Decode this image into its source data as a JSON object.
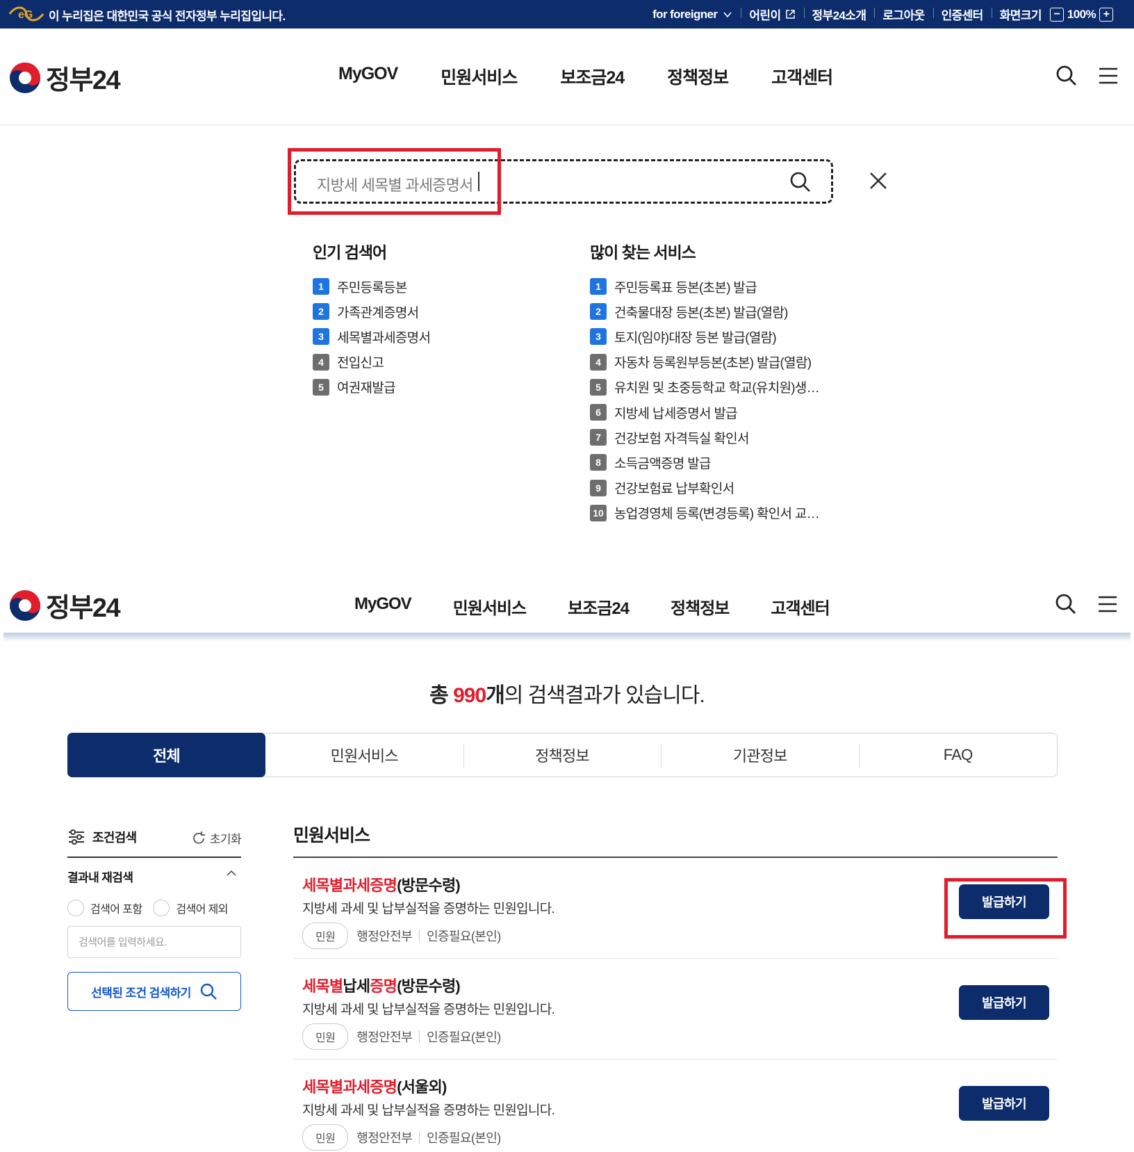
{
  "topbar": {
    "official_notice": "이 누리집은 대한민국 공식 전자정부 누리집입니다.",
    "links": {
      "foreigner": "for foreigner",
      "kids": "어린이",
      "about": "정부24소개",
      "logout": "로그아웃",
      "cert_center": "인증센터",
      "screen_size": "화면크기"
    },
    "zoom_minus": "−",
    "zoom_value": "100%",
    "zoom_plus": "+"
  },
  "header": {
    "logo_text": "정부24",
    "nav": [
      "MyGOV",
      "민원서비스",
      "보조금24",
      "정책정보",
      "고객센터"
    ]
  },
  "search": {
    "query": "지방세 세목별 과세증명서"
  },
  "popular": {
    "title": "인기 검색어",
    "items": [
      {
        "rank": "1",
        "label": "주민등록등본"
      },
      {
        "rank": "2",
        "label": "가족관계증명서"
      },
      {
        "rank": "3",
        "label": "세목별과세증명서"
      },
      {
        "rank": "4",
        "label": "전입신고"
      },
      {
        "rank": "5",
        "label": "여권재발급"
      }
    ]
  },
  "frequent": {
    "title": "많이 찾는 서비스",
    "items": [
      {
        "rank": "1",
        "label": "주민등록표 등본(초본) 발급"
      },
      {
        "rank": "2",
        "label": "건축물대장 등본(초본) 발급(열람)"
      },
      {
        "rank": "3",
        "label": "토지(임야)대장 등본 발급(열람)"
      },
      {
        "rank": "4",
        "label": "자동차 등록원부등본(초본) 발급(열람)"
      },
      {
        "rank": "5",
        "label": "유치원 및 초중등학교 학교(유치원)생…"
      },
      {
        "rank": "6",
        "label": "지방세 납세증명서 발급"
      },
      {
        "rank": "7",
        "label": "건강보험 자격득실 확인서"
      },
      {
        "rank": "8",
        "label": "소득금액증명 발급"
      },
      {
        "rank": "9",
        "label": "건강보험료 납부확인서"
      },
      {
        "rank": "10",
        "label": "농업경영체 등록(변경등록) 확인서 교…"
      }
    ]
  },
  "results": {
    "summary_prefix": "총",
    "count": "990",
    "summary_unit": "개",
    "summary_suffix": "의 검색결과가 있습니다.",
    "tabs": [
      "전체",
      "민원서비스",
      "정책정보",
      "기관정보",
      "FAQ"
    ],
    "active_tab": "전체",
    "filter": {
      "title": "조건검색",
      "reset": "초기화",
      "refine_title": "결과내 재검색",
      "include_label": "검색어 포함",
      "exclude_label": "검색어 제외",
      "input_placeholder": "검색어를 입력하세요.",
      "search_button": "선택된 조건 검색하기"
    },
    "section_title": "민원서비스",
    "items": [
      {
        "title_parts": [
          {
            "text": "세목별과세증명",
            "hl": true
          },
          {
            "text": "(방문수령)",
            "hl": false
          }
        ],
        "desc": "지방세 과세 및 납부실적을 증명하는 민원입니다.",
        "tag": "민원",
        "org": "행정안전부",
        "auth": "인증필요(본인)",
        "button": "발급하기"
      },
      {
        "title_parts": [
          {
            "text": "세목별",
            "hl": true
          },
          {
            "text": "납세",
            "hl": false
          },
          {
            "text": "증명",
            "hl": true
          },
          {
            "text": "(방문수령)",
            "hl": false
          }
        ],
        "desc": "지방세 과세 및 납부실적을 증명하는 민원입니다.",
        "tag": "민원",
        "org": "행정안전부",
        "auth": "인증필요(본인)",
        "button": "발급하기"
      },
      {
        "title_parts": [
          {
            "text": "세목별과세증명",
            "hl": true
          },
          {
            "text": "(서울외)",
            "hl": false
          }
        ],
        "desc": "지방세 과세 및 납부실적을 증명하는 민원입니다.",
        "tag": "민원",
        "org": "행정안전부",
        "auth": "인증필요(본인)",
        "button": "발급하기"
      }
    ]
  },
  "colors": {
    "navy": "#0c2c6b",
    "highlight_red": "#e11d2b",
    "rank_blue": "#1f74e0",
    "rank_gray": "#6e6e6e"
  }
}
